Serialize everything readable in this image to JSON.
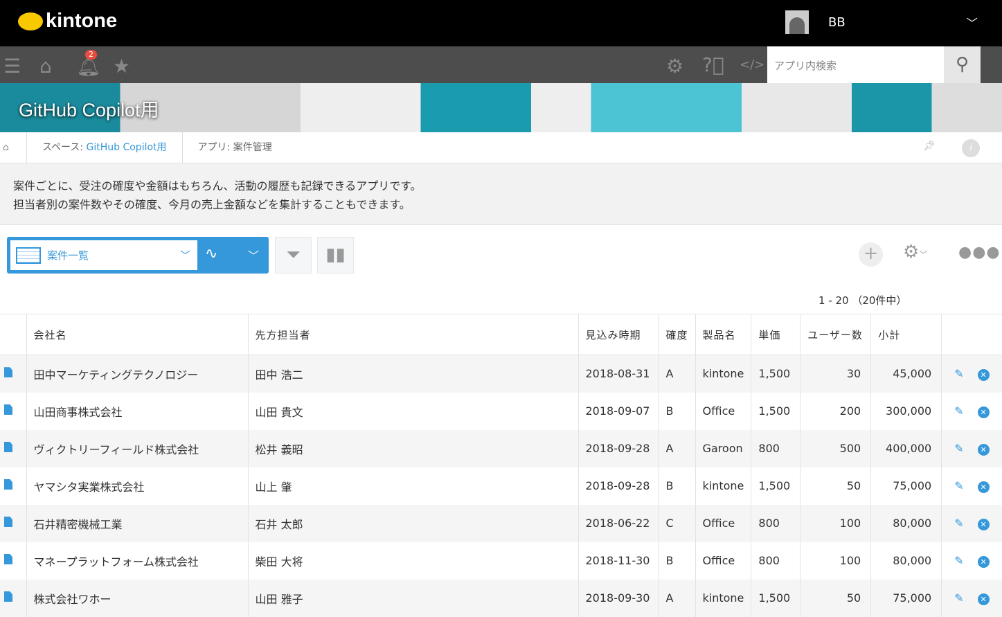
{
  "header": {
    "logo": "kintone",
    "user": "BB"
  },
  "nav": {
    "notification_count": "2",
    "search_placeholder": "アプリ内検索"
  },
  "banner": {
    "title": "GitHub Copilot用"
  },
  "breadcrumb": {
    "space_prefix": "スペース: ",
    "space": "GitHub Copilot用",
    "app": "アプリ: 案件管理"
  },
  "description": [
    "案件ごとに、受注の確度や金額はもちろん、活動の履歴も記録できるアプリです。",
    "担当者別の案件数やその確度、今月の売上金額などを集計することもできます。"
  ],
  "view": {
    "name": "案件一覧",
    "pager": "1 - 20 （20件中）"
  },
  "table": {
    "columns": [
      "会社名",
      "先方担当者",
      "見込み時期",
      "確度",
      "製品名",
      "単価",
      "ユーザー数",
      "小計"
    ],
    "rows": [
      [
        "田中マーケティングテクノロジー",
        "田中 浩二",
        "2018-08-31",
        "A",
        "kintone",
        "1,500",
        "30",
        "45,000"
      ],
      [
        "山田商事株式会社",
        "山田 貴文",
        "2018-09-07",
        "B",
        "Office",
        "1,500",
        "200",
        "300,000"
      ],
      [
        "ヴィクトリーフィールド株式会社",
        "松井 義昭",
        "2018-09-28",
        "A",
        "Garoon",
        "800",
        "500",
        "400,000"
      ],
      [
        "ヤマシタ実業株式会社",
        "山上 肇",
        "2018-09-28",
        "B",
        "kintone",
        "1,500",
        "50",
        "75,000"
      ],
      [
        "石井精密機械工業",
        "石井 太郎",
        "2018-06-22",
        "C",
        "Office",
        "800",
        "100",
        "80,000"
      ],
      [
        "マネープラットフォーム株式会社",
        "柴田 大将",
        "2018-11-30",
        "B",
        "Office",
        "800",
        "100",
        "80,000"
      ],
      [
        "株式会社ワホー",
        "山田 雅子",
        "2018-09-30",
        "A",
        "kintone",
        "1,500",
        "50",
        "75,000"
      ]
    ]
  }
}
